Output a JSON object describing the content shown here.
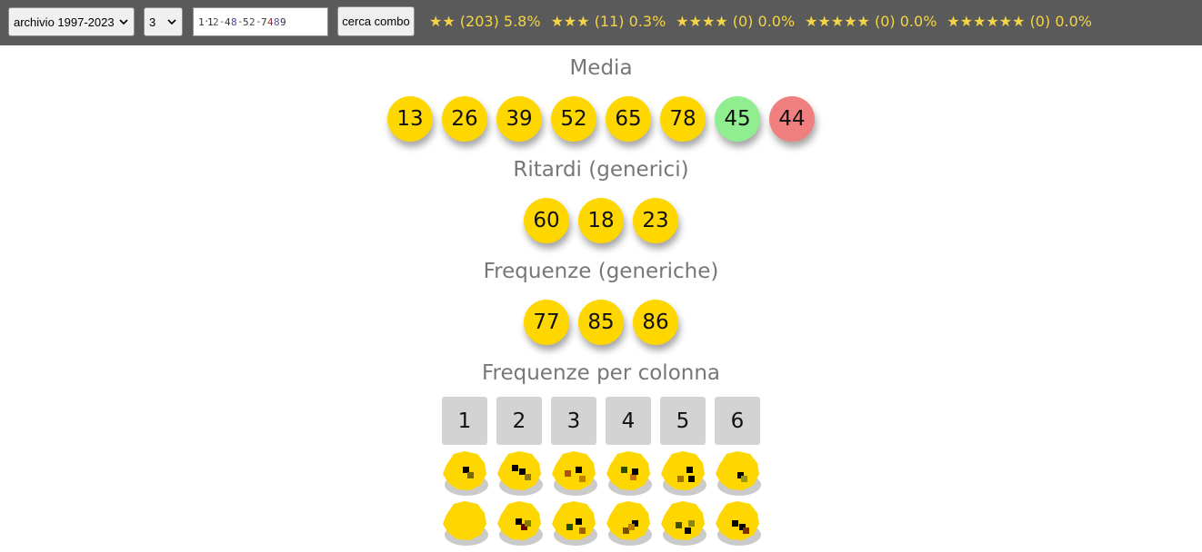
{
  "toolbar": {
    "archive_select": "archivio 1997-2023",
    "count_select": "3",
    "combo_input_value": "",
    "search_button": "cerca combo",
    "stats": [
      {
        "stars": "★★",
        "count": "(203)",
        "pct": "5.8%"
      },
      {
        "stars": "★★★",
        "count": "(11)",
        "pct": "0.3%"
      },
      {
        "stars": "★★★★",
        "count": "(0)",
        "pct": "0.0%"
      },
      {
        "stars": "★★★★★",
        "count": "(0)",
        "pct": "0.0%"
      },
      {
        "stars": "★★★★★★",
        "count": "(0)",
        "pct": "0.0%"
      }
    ]
  },
  "sections": {
    "media": {
      "title": "Media",
      "balls": [
        {
          "num": "13",
          "color": "#ffd700"
        },
        {
          "num": "26",
          "color": "#ffd700"
        },
        {
          "num": "39",
          "color": "#ffd700"
        },
        {
          "num": "52",
          "color": "#ffd700"
        },
        {
          "num": "65",
          "color": "#ffd700"
        },
        {
          "num": "78",
          "color": "#ffd700"
        },
        {
          "num": "45",
          "color": "#90ee90"
        },
        {
          "num": "44",
          "color": "#f08080"
        }
      ]
    },
    "ritardi": {
      "title": "Ritardi (generici)",
      "balls": [
        "60",
        "18",
        "23"
      ]
    },
    "frequenze": {
      "title": "Frequenze (generiche)",
      "balls": [
        "77",
        "85",
        "86"
      ]
    },
    "colonne": {
      "title": "Frequenze per colonna",
      "columns": [
        "1",
        "2",
        "3",
        "4",
        "5",
        "6"
      ]
    }
  },
  "colors": {
    "topbar_bg": "#5a5a5a",
    "stats_text": "#f5d547",
    "ball_yellow": "#ffd700",
    "ball_green": "#90ee90",
    "ball_red": "#f08080",
    "column_box": "#d3d3d3"
  }
}
